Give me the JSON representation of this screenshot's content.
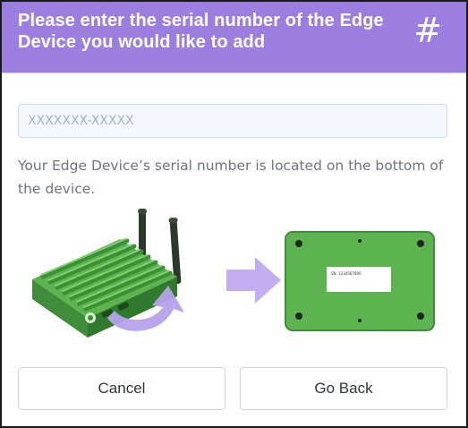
{
  "header": {
    "title": "Please enter the serial number of the Edge Device you would like to add",
    "icon": "hash-icon",
    "icon_glyph": "#",
    "color": "#9b7ee0"
  },
  "serial_input": {
    "value": "",
    "placeholder": "XXXXXXX-XXXXX"
  },
  "help_text": "Your Edge Device’s serial number is located on the bottom of the device.",
  "illustration": {
    "device_icon": "edge-device-top-icon",
    "arrow_icon": "arrow-right-icon",
    "device_bottom_icon": "edge-device-bottom-icon",
    "label_text": "SN: 1234567890"
  },
  "buttons": {
    "cancel": "Cancel",
    "go_back": "Go Back"
  }
}
